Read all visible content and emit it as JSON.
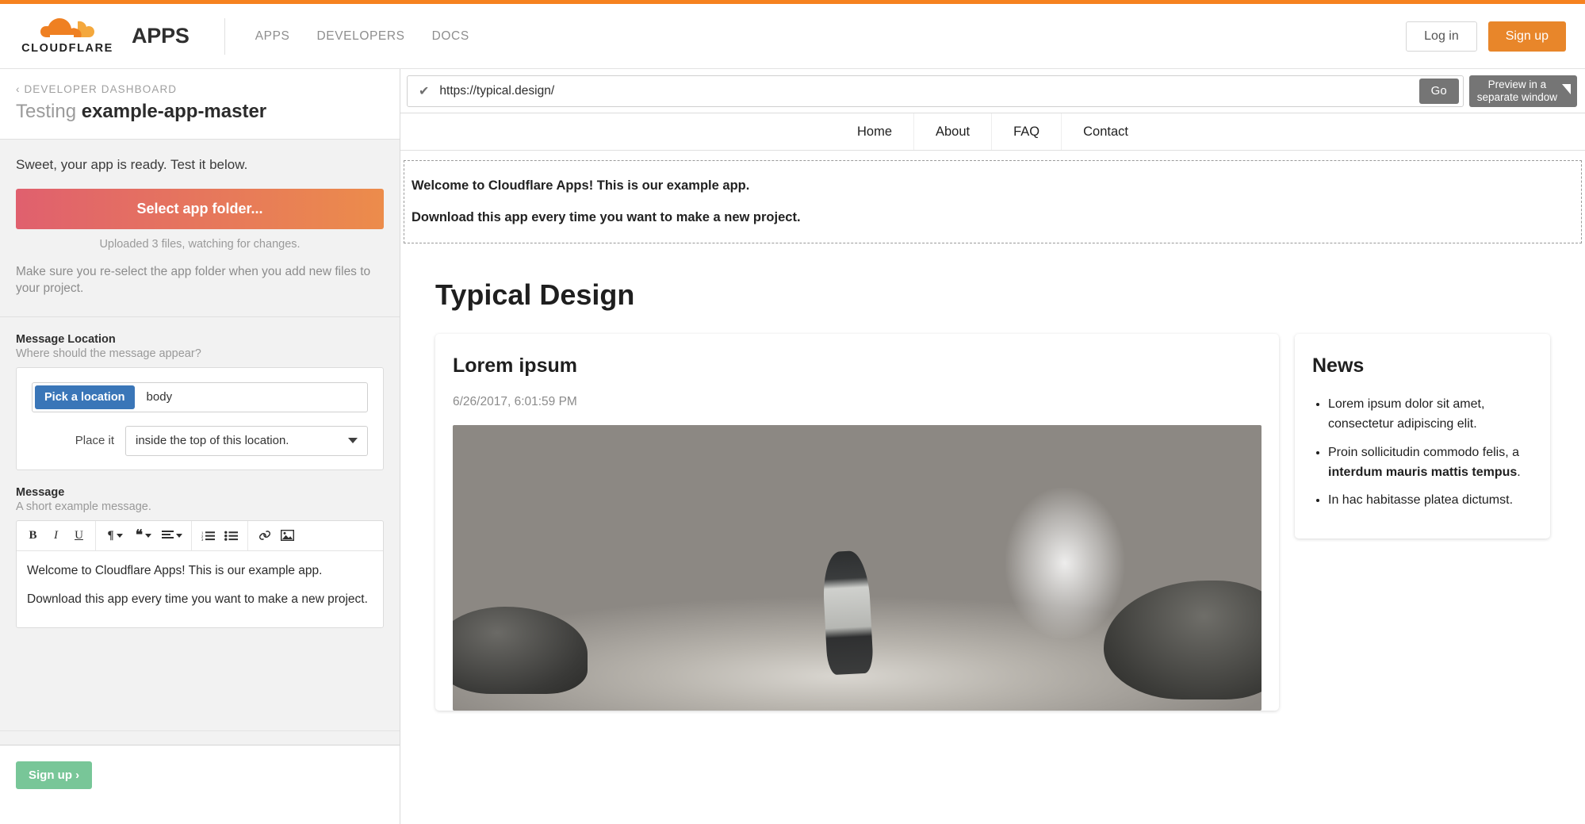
{
  "header": {
    "brand_wordmark": "CLOUDFLARE",
    "brand_suffix": "APPS",
    "nav": [
      {
        "label": "APPS"
      },
      {
        "label": "DEVELOPERS"
      },
      {
        "label": "DOCS"
      }
    ],
    "login_label": "Log in",
    "signup_label": "Sign up",
    "accent_orange": "#f6821f"
  },
  "sidebar": {
    "breadcrumb": "‹ DEVELOPER DASHBOARD",
    "title_prefix": "Testing ",
    "title_app": "example-app-master",
    "ready_text": "Sweet, your app is ready. Test it below.",
    "select_folder_label": "Select app folder...",
    "uploaded_note": "Uploaded 3 files, watching for changes.",
    "reselect_note": "Make sure you re-select the app folder when you add new files to your project.",
    "location_field": {
      "label": "Message Location",
      "help": "Where should the message appear?",
      "pick_button": "Pick a location",
      "value": "body",
      "place_label": "Place it",
      "place_value": "inside the top of this location."
    },
    "message_field": {
      "label": "Message",
      "help": "A short example message.",
      "toolbar": [
        {
          "icon": "bold-icon",
          "glyph": "B"
        },
        {
          "icon": "italic-icon",
          "glyph": "I"
        },
        {
          "icon": "underline-icon",
          "glyph": "U"
        },
        {
          "icon": "paragraph-format-icon",
          "glyph": "¶"
        },
        {
          "icon": "blockquote-icon",
          "glyph": "❝"
        },
        {
          "icon": "align-icon",
          "glyph": "≡"
        },
        {
          "icon": "ordered-list-icon",
          "glyph": "1."
        },
        {
          "icon": "unordered-list-icon",
          "glyph": "•"
        },
        {
          "icon": "link-icon",
          "glyph": "🔗"
        },
        {
          "icon": "image-icon",
          "glyph": "🖼"
        }
      ],
      "paragraphs": [
        "Welcome to Cloudflare Apps! This is our example app.",
        "Download this app every time you want to make a new project."
      ]
    },
    "footer_signup_label": "Sign up ›",
    "footer_signup_color": "#78c698"
  },
  "preview": {
    "url_value": "https://typical.design/",
    "url_status_icon": "checkmark-icon",
    "go_label": "Go",
    "preview_window_label_line1": "Preview in a",
    "preview_window_label_line2": "separate window"
  },
  "site": {
    "nav": [
      {
        "label": "Home"
      },
      {
        "label": "About"
      },
      {
        "label": "FAQ"
      },
      {
        "label": "Contact"
      }
    ],
    "injected_message": [
      "Welcome to Cloudflare Apps! This is our example app.",
      "Download this app every time you want to make a new project."
    ],
    "heading": "Typical Design",
    "post": {
      "title": "Lorem ipsum",
      "date": "6/26/2017, 6:01:59 PM",
      "image_alt": "woman-on-rocky-shore-photo"
    },
    "news": {
      "title": "News",
      "items": [
        {
          "plain": "Lorem ipsum dolor sit amet, consectetur adipiscing elit."
        },
        {
          "pre": "Proin sollicitudin commodo felis, a ",
          "bold": "interdum mauris mattis tempus",
          "post": "."
        },
        {
          "plain": "In hac habitasse platea dictumst."
        }
      ]
    }
  }
}
